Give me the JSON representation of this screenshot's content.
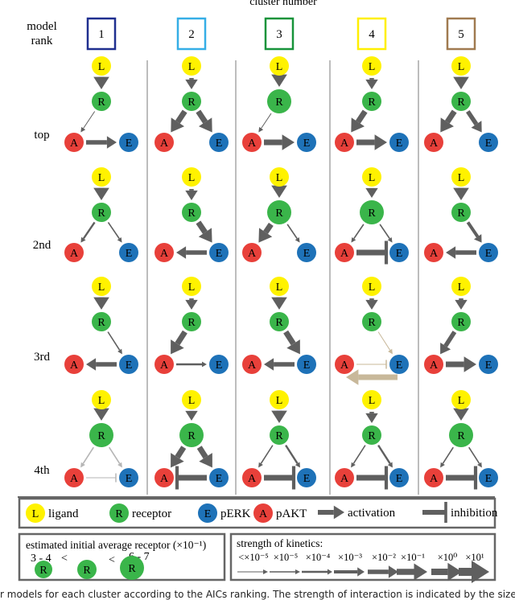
{
  "header": {
    "title": "cluster number",
    "rank_label_line1": "model",
    "rank_label_line2": "rank"
  },
  "clusters": [
    {
      "label": "1",
      "color": "#1f2f8f"
    },
    {
      "label": "2",
      "color": "#35aee6"
    },
    {
      "label": "3",
      "color": "#17933a"
    },
    {
      "label": "4",
      "color": "#ffef00"
    },
    {
      "label": "5",
      "color": "#a07a50"
    }
  ],
  "ranks": [
    "top",
    "2nd",
    "3rd",
    "4th"
  ],
  "node_colors": {
    "L": "#fff200",
    "R": "#3ab54a",
    "A": "#e8403a",
    "E": "#1e72b8"
  },
  "edge_colors": {
    "normal": "#5f5f5f",
    "faint": "#b5b5b5",
    "tan": "#c8b89a"
  },
  "models": [
    [
      {
        "R_size": "small",
        "edges": [
          {
            "from": "L",
            "to": "R",
            "type": "activation",
            "strength": "x10^-1"
          },
          {
            "from": "R",
            "to": "A",
            "type": "activation",
            "strength": "<x10^-5"
          },
          {
            "from": "A",
            "to": "E",
            "type": "activation",
            "strength": "x10^-2"
          }
        ]
      },
      {
        "R_size": "small",
        "edges": [
          {
            "from": "L",
            "to": "R",
            "type": "activation",
            "strength": "x10^-1"
          },
          {
            "from": "R",
            "to": "A",
            "type": "activation",
            "strength": "x10^-4"
          },
          {
            "from": "R",
            "to": "E",
            "type": "activation",
            "strength": "x10^-5"
          }
        ]
      },
      {
        "R_size": "small",
        "edges": [
          {
            "from": "L",
            "to": "R",
            "type": "activation",
            "strength": "x10^-1"
          },
          {
            "from": "R",
            "to": "E",
            "type": "activation",
            "strength": "x10^-5"
          },
          {
            "from": "E",
            "to": "A",
            "type": "activation",
            "strength": "x10^-2"
          }
        ]
      },
      {
        "R_size": "large",
        "edges": [
          {
            "from": "L",
            "to": "R",
            "type": "activation",
            "strength": "x10^-1"
          },
          {
            "from": "R",
            "to": "A",
            "type": "activation",
            "strength": "x10^-5",
            "faint": true
          },
          {
            "from": "R",
            "to": "E",
            "type": "activation",
            "strength": "x10^-5",
            "faint": true
          },
          {
            "from": "A",
            "to": "E",
            "type": "inhibition",
            "strength": "<x10^-5",
            "faint": true
          }
        ]
      }
    ],
    [
      {
        "R_size": "small",
        "edges": [
          {
            "from": "L",
            "to": "R",
            "type": "activation",
            "strength": "x10^-2"
          },
          {
            "from": "R",
            "to": "A",
            "type": "activation",
            "strength": "x10^-1"
          },
          {
            "from": "R",
            "to": "E",
            "type": "activation",
            "strength": "x10^-1"
          }
        ]
      },
      {
        "R_size": "small",
        "edges": [
          {
            "from": "L",
            "to": "R",
            "type": "activation",
            "strength": "x10^-2"
          },
          {
            "from": "R",
            "to": "E",
            "type": "activation",
            "strength": "x10^-1"
          },
          {
            "from": "E",
            "to": "A",
            "type": "activation",
            "strength": "x10^-2"
          }
        ]
      },
      {
        "R_size": "small",
        "edges": [
          {
            "from": "L",
            "to": "R",
            "type": "activation",
            "strength": "x10^-2"
          },
          {
            "from": "R",
            "to": "A",
            "type": "activation",
            "strength": "x10^-1"
          },
          {
            "from": "A",
            "to": "E",
            "type": "activation",
            "strength": "x10^-4"
          }
        ]
      },
      {
        "R_size": "large",
        "edges": [
          {
            "from": "L",
            "to": "R",
            "type": "activation",
            "strength": "x10^-2"
          },
          {
            "from": "R",
            "to": "A",
            "type": "activation",
            "strength": "x10^-1"
          },
          {
            "from": "R",
            "to": "E",
            "type": "activation",
            "strength": "x10^-1"
          },
          {
            "from": "E",
            "to": "A",
            "type": "inhibition",
            "strength": "x10^-1"
          }
        ]
      }
    ],
    [
      {
        "R_size": "large",
        "edges": [
          {
            "from": "L",
            "to": "R",
            "type": "activation",
            "strength": "x10^-1"
          },
          {
            "from": "R",
            "to": "A",
            "type": "activation",
            "strength": "<x10^-5"
          },
          {
            "from": "A",
            "to": "E",
            "type": "activation",
            "strength": "x10^-1"
          }
        ]
      },
      {
        "R_size": "large",
        "edges": [
          {
            "from": "L",
            "to": "R",
            "type": "activation",
            "strength": "x10^-1"
          },
          {
            "from": "R",
            "to": "A",
            "type": "activation",
            "strength": "x10^-1"
          },
          {
            "from": "R",
            "to": "E",
            "type": "activation",
            "strength": "x10^-5"
          }
        ]
      },
      {
        "R_size": "small",
        "edges": [
          {
            "from": "L",
            "to": "R",
            "type": "activation",
            "strength": "x10^-1"
          },
          {
            "from": "R",
            "to": "E",
            "type": "activation",
            "strength": "x10^-1"
          },
          {
            "from": "E",
            "to": "A",
            "type": "activation",
            "strength": "x10^-2"
          }
        ]
      },
      {
        "R_size": "small",
        "edges": [
          {
            "from": "L",
            "to": "R",
            "type": "activation",
            "strength": "x10^-1"
          },
          {
            "from": "R",
            "to": "A",
            "type": "activation",
            "strength": "x10^-5"
          },
          {
            "from": "R",
            "to": "E",
            "type": "activation",
            "strength": "x10^-4"
          },
          {
            "from": "A",
            "to": "E",
            "type": "inhibition",
            "strength": "x10^-1"
          }
        ]
      }
    ],
    [
      {
        "R_size": "small",
        "edges": [
          {
            "from": "L",
            "to": "R",
            "type": "activation",
            "strength": "x10^-2"
          },
          {
            "from": "R",
            "to": "A",
            "type": "activation",
            "strength": "x10^-1"
          },
          {
            "from": "A",
            "to": "E",
            "type": "activation",
            "strength": "x10^-1"
          }
        ]
      },
      {
        "R_size": "large",
        "edges": [
          {
            "from": "L",
            "to": "R",
            "type": "activation",
            "strength": "x10^-2"
          },
          {
            "from": "R",
            "to": "A",
            "type": "activation",
            "strength": "x10^-5"
          },
          {
            "from": "R",
            "to": "E",
            "type": "activation",
            "strength": "x10^-5"
          },
          {
            "from": "A",
            "to": "E",
            "type": "inhibition",
            "strength": "x10^-1"
          }
        ]
      },
      {
        "R_size": "small",
        "edges": [
          {
            "from": "L",
            "to": "R",
            "type": "activation",
            "strength": "x10^-2"
          },
          {
            "from": "R",
            "to": "E",
            "type": "activation",
            "strength": "<x10^-5",
            "tan": true
          },
          {
            "from": "A",
            "to": "E",
            "type": "inhibition",
            "strength": "<x10^-5",
            "tan": true
          },
          {
            "from": "E",
            "to": "A",
            "type": "activation",
            "strength": "x10^-1",
            "tan": true,
            "offset": true
          }
        ]
      },
      {
        "R_size": "small",
        "edges": [
          {
            "from": "L",
            "to": "R",
            "type": "activation",
            "strength": "x10^-2"
          },
          {
            "from": "R",
            "to": "A",
            "type": "activation",
            "strength": "x10^-5"
          },
          {
            "from": "R",
            "to": "E",
            "type": "activation",
            "strength": "x10^-4"
          },
          {
            "from": "A",
            "to": "E",
            "type": "inhibition",
            "strength": "x10^-1"
          }
        ]
      }
    ],
    [
      {
        "R_size": "small",
        "edges": [
          {
            "from": "L",
            "to": "R",
            "type": "activation",
            "strength": "x10^-1"
          },
          {
            "from": "R",
            "to": "A",
            "type": "activation",
            "strength": "x10^-1"
          },
          {
            "from": "R",
            "to": "E",
            "type": "activation",
            "strength": "x10^-2"
          }
        ]
      },
      {
        "R_size": "small",
        "edges": [
          {
            "from": "L",
            "to": "R",
            "type": "activation",
            "strength": "x10^-1"
          },
          {
            "from": "R",
            "to": "E",
            "type": "activation",
            "strength": "x10^-3"
          },
          {
            "from": "E",
            "to": "A",
            "type": "activation",
            "strength": "x10^-2"
          }
        ]
      },
      {
        "R_size": "small",
        "edges": [
          {
            "from": "L",
            "to": "R",
            "type": "activation",
            "strength": "x10^-2"
          },
          {
            "from": "R",
            "to": "A",
            "type": "activation",
            "strength": "x10^-2"
          },
          {
            "from": "A",
            "to": "E",
            "type": "activation",
            "strength": "x10^-1"
          }
        ]
      },
      {
        "R_size": "large",
        "edges": [
          {
            "from": "L",
            "to": "R",
            "type": "activation",
            "strength": "x10^-1"
          },
          {
            "from": "R",
            "to": "A",
            "type": "activation",
            "strength": "x10^-5"
          },
          {
            "from": "R",
            "to": "E",
            "type": "activation",
            "strength": "x10^-5"
          },
          {
            "from": "A",
            "to": "E",
            "type": "inhibition",
            "strength": "x10^-1"
          }
        ]
      }
    ]
  ],
  "legend": {
    "items": [
      {
        "glyph": "L",
        "label": "ligand"
      },
      {
        "glyph": "R",
        "label": "receptor"
      },
      {
        "glyph": "E",
        "label": "pERK"
      },
      {
        "glyph": "A",
        "label": "pAKT"
      }
    ],
    "activation_label": "activation",
    "inhibition_label": "inhibition"
  },
  "receptor_legend": {
    "title": "estimated initial average receptor (×10⁻¹)",
    "low": "3 - 4",
    "lt1": "<",
    "lt2": "<",
    "high": "6 - 7",
    "glyph": "R"
  },
  "kinetics_legend": {
    "title": "strength of kinetics:",
    "levels": [
      "<×10⁻⁵",
      "×10⁻⁵",
      "×10⁻⁴",
      "×10⁻³",
      "×10⁻²",
      "×10⁻¹",
      "×10⁰",
      "×10¹"
    ]
  },
  "caption": "r models for each cluster according to the AICs ranking. The strength of interaction is indicated by the size of the"
}
